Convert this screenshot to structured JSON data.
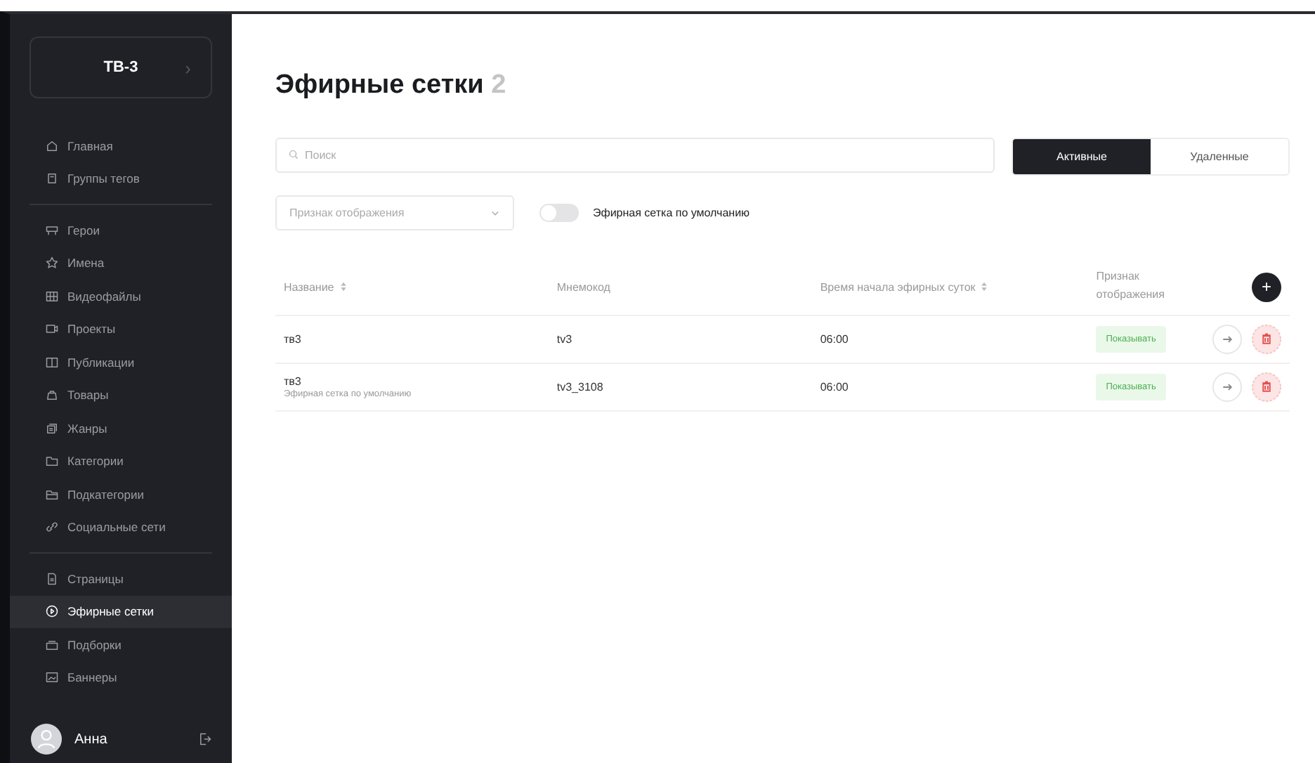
{
  "sidebar": {
    "brand": "ТВ-3",
    "brand_arrow": "›",
    "groups": [
      {
        "items": [
          {
            "label": "Главная",
            "selected": false
          },
          {
            "label": "Группы тегов",
            "selected": false
          }
        ]
      },
      {
        "items": [
          {
            "label": "Герои",
            "selected": false
          },
          {
            "label": "Имена",
            "selected": false
          },
          {
            "label": "Видеофайлы",
            "selected": false
          },
          {
            "label": "Проекты",
            "selected": false
          },
          {
            "label": "Публикации",
            "selected": false
          },
          {
            "label": "Товары",
            "selected": false
          },
          {
            "label": "Жанры",
            "selected": false
          },
          {
            "label": "Категории",
            "selected": false
          },
          {
            "label": "Подкатегории",
            "selected": false
          },
          {
            "label": "Социальные сети",
            "selected": false
          }
        ]
      },
      {
        "items": [
          {
            "label": "Страницы",
            "selected": false
          },
          {
            "label": "Эфирные сетки",
            "selected": true
          },
          {
            "label": "Подборки",
            "selected": false
          },
          {
            "label": "Баннеры",
            "selected": false
          }
        ]
      }
    ],
    "user": {
      "name": "Анна"
    }
  },
  "page": {
    "title": "Эфирные сетки",
    "count": "2"
  },
  "search": {
    "placeholder": "Поиск"
  },
  "tabs": [
    {
      "label": "Активные",
      "selected": true
    },
    {
      "label": "Удаленные",
      "selected": false
    }
  ],
  "filter": {
    "placeholder": "Признак отображения"
  },
  "default_toggle": {
    "label": "Эфирная сетка по умолчанию",
    "on": false
  },
  "table": {
    "columns": [
      {
        "label": "Название",
        "sortable": true
      },
      {
        "label": "Мнемокод",
        "sortable": false
      },
      {
        "label": "Время начала эфирных суток",
        "sortable": true
      },
      {
        "label": "Признак отображения",
        "sortable": false
      }
    ],
    "add_button": "+",
    "rows": [
      {
        "name": "тв3",
        "code": "tv3",
        "time": "06:00",
        "status": "Показывать"
      },
      {
        "name": "тв3",
        "subtitle": "Эфирная сетка по умолчанию",
        "code": "tv3_3108",
        "time": "06:00",
        "status": "Показывать"
      }
    ]
  }
}
